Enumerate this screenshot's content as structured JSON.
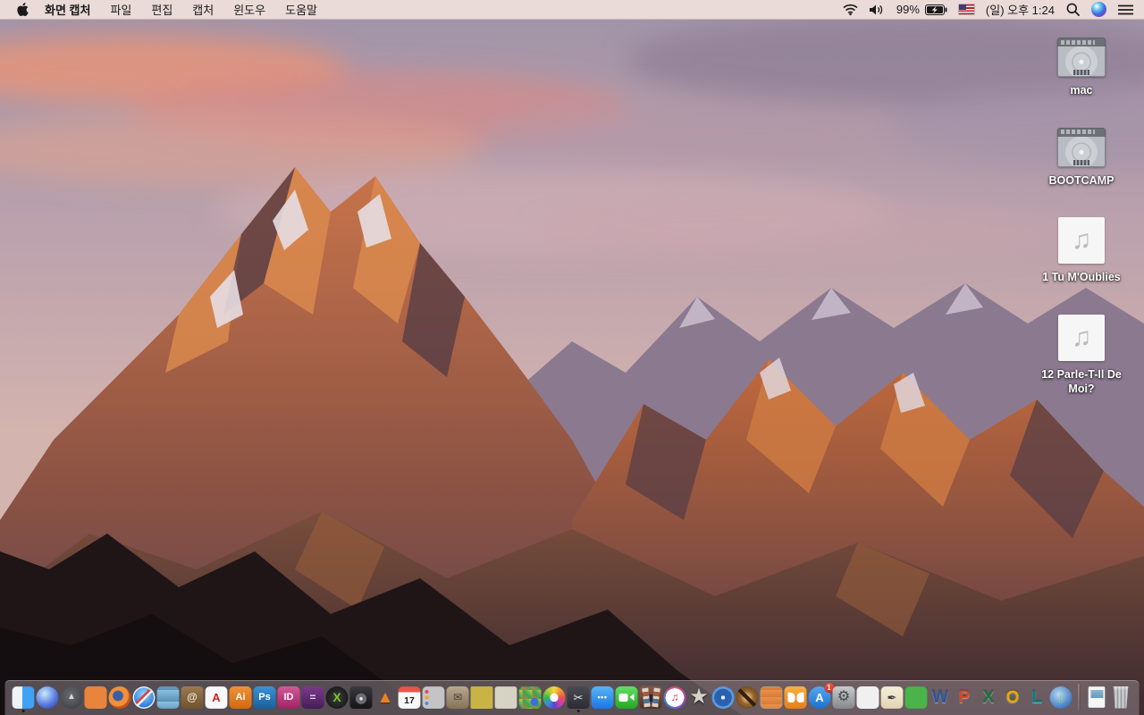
{
  "menu_bar": {
    "app_name": "화면 캡처",
    "menus": [
      "파일",
      "편집",
      "캡처",
      "윈도우",
      "도움말"
    ],
    "battery_percent": "99%",
    "clock": "(일) 오후 1:24",
    "status_icons": [
      "wifi-icon",
      "volume-icon",
      "battery-charging-icon",
      "input-source-us-flag",
      "spotlight-search-icon",
      "siri-icon",
      "notification-center-icon"
    ]
  },
  "desktop": {
    "icons": [
      {
        "id": "mac",
        "label": "mac",
        "type": "hard-drive",
        "glyph": ""
      },
      {
        "id": "bootcamp",
        "label": "BOOTCAMP",
        "type": "hard-drive",
        "glyph": ""
      },
      {
        "id": "tu-moublies",
        "label": "1 Tu M'Oublies",
        "type": "audio-file",
        "glyph": "♫"
      },
      {
        "id": "parle-t-il-de-moi",
        "label": "12 Parle-T-Il De Moi?",
        "type": "audio-file",
        "glyph": "♫"
      }
    ]
  },
  "dock": {
    "apps": [
      {
        "id": "finder",
        "glyph": "",
        "running": true
      },
      {
        "id": "siri",
        "glyph": ""
      },
      {
        "id": "launchpad",
        "glyph": "▲"
      },
      {
        "id": "mission-control",
        "glyph": ""
      },
      {
        "id": "firefox",
        "glyph": ""
      },
      {
        "id": "safari",
        "glyph": ""
      },
      {
        "id": "preview",
        "glyph": ""
      },
      {
        "id": "contacts",
        "glyph": "@"
      },
      {
        "id": "acrobat-reader",
        "glyph": "A"
      },
      {
        "id": "illustrator",
        "glyph": "Ai"
      },
      {
        "id": "photoshop",
        "glyph": "Ps"
      },
      {
        "id": "indesign",
        "glyph": "ID"
      },
      {
        "id": "toast",
        "glyph": "="
      },
      {
        "id": "x-media-app",
        "glyph": "X"
      },
      {
        "id": "disk-utility-app",
        "glyph": ""
      },
      {
        "id": "vlc",
        "glyph": "▲"
      },
      {
        "id": "calendar",
        "glyph": "17"
      },
      {
        "id": "reminders",
        "glyph": ""
      },
      {
        "id": "archive-box-app",
        "glyph": "✉"
      },
      {
        "id": "stickies",
        "glyph": ""
      },
      {
        "id": "notes",
        "glyph": ""
      },
      {
        "id": "colorsync-document-app",
        "glyph": ""
      },
      {
        "id": "photos",
        "glyph": ""
      },
      {
        "id": "grab-screen-capture",
        "glyph": "✂",
        "running": true
      },
      {
        "id": "messages",
        "glyph": "•••"
      },
      {
        "id": "facetime",
        "glyph": ""
      },
      {
        "id": "photo-booth",
        "glyph": ""
      },
      {
        "id": "itunes",
        "glyph": "♫"
      },
      {
        "id": "imovie",
        "glyph": "★"
      },
      {
        "id": "idvd",
        "glyph": ""
      },
      {
        "id": "garageband",
        "glyph": ""
      },
      {
        "id": "iweb",
        "glyph": ""
      },
      {
        "id": "ibooks",
        "glyph": ""
      },
      {
        "id": "app-store",
        "glyph": "A",
        "badge": "1"
      },
      {
        "id": "system-preferences",
        "glyph": "⚙"
      },
      {
        "id": "keynote",
        "glyph": ""
      },
      {
        "id": "pages",
        "glyph": "✒"
      },
      {
        "id": "numbers",
        "glyph": ""
      },
      {
        "id": "word",
        "glyph": "W"
      },
      {
        "id": "powerpoint",
        "glyph": "P"
      },
      {
        "id": "excel",
        "glyph": "X"
      },
      {
        "id": "outlook",
        "glyph": "O"
      },
      {
        "id": "lync",
        "glyph": "L"
      },
      {
        "id": "download-manager",
        "glyph": "↓"
      }
    ],
    "right_items": [
      {
        "id": "document-file",
        "glyph": ""
      },
      {
        "id": "trash",
        "glyph": ""
      }
    ]
  },
  "colors": {
    "menubar_bg": "#ecddda",
    "menubar_text": "#1a1a1a",
    "sky_top": "#a394a8",
    "cloud_pink": "#e89478",
    "mountain_lit": "#c1693c",
    "mountain_shadow": "#5c4350",
    "foreground_rock": "#1f1517",
    "dock_bg": "#968c92",
    "badge_red": "#e03422"
  }
}
